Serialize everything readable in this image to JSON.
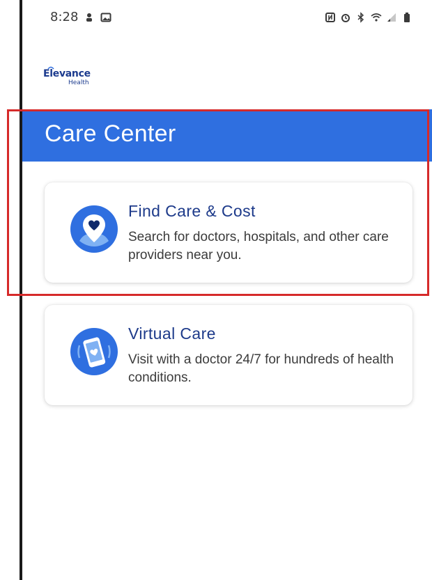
{
  "status_bar": {
    "time": "8:28",
    "left_icons": [
      "notification-icon",
      "gallery-icon"
    ],
    "right_icons": [
      "nfc-icon",
      "alarm-icon",
      "bluetooth-icon",
      "wifi-icon",
      "signal-icon",
      "battery-icon"
    ]
  },
  "brand": {
    "logo_main": "Elevance",
    "logo_sub": "Health"
  },
  "header": {
    "title": "Care Center",
    "color": "#2f6fe0"
  },
  "cards": [
    {
      "title": "Find Care & Cost",
      "description": "Search for doctors, hospitals, and other care providers near you.",
      "icon": "location-heart-icon"
    },
    {
      "title": "Virtual Care",
      "description": "Visit with a doctor 24/7 for hundreds of health conditions.",
      "icon": "phone-heart-icon"
    }
  ],
  "colors": {
    "accent": "#2f6fe0",
    "title_text": "#1d3a8a",
    "highlight": "#d62a2a"
  }
}
